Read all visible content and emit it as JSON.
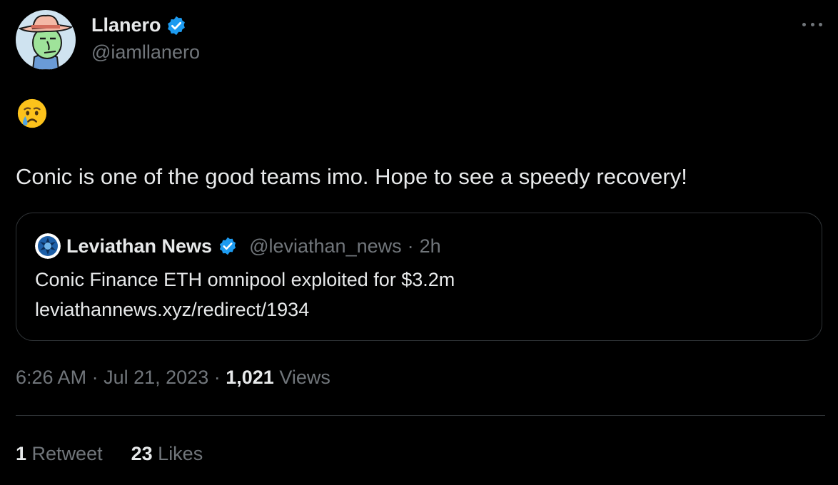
{
  "author": {
    "display_name": "Llanero",
    "handle": "@iamllanero",
    "verified": true,
    "avatar_icon": "cowboy-avatar"
  },
  "menu": {
    "icon": "more-horizontal-icon"
  },
  "tweet": {
    "emoji": "crying-face-emoji",
    "text": "Conic is one of the good teams imo. Hope to see a speedy recovery!"
  },
  "quote": {
    "display_name": "Leviathan News",
    "handle": "@leviathan_news",
    "separator": "·",
    "time": "2h",
    "line1": "Conic Finance ETH omnipool exploited for $3.2m",
    "line2": "leviathannews.xyz/redirect/1934",
    "avatar_icon": "leviathan-logo"
  },
  "meta": {
    "time": "6:26 AM",
    "date": "Jul 21, 2023",
    "separator": "·",
    "views_count": "1,021",
    "views_label": "Views"
  },
  "stats": {
    "retweets_count": "1",
    "retweets_label": "Retweet",
    "likes_count": "23",
    "likes_label": "Likes"
  },
  "colors": {
    "background": "#000000",
    "text_primary": "#e7e9ea",
    "text_secondary": "#71767b",
    "border": "#2f3336",
    "verified_badge": "#1d9bf0"
  }
}
